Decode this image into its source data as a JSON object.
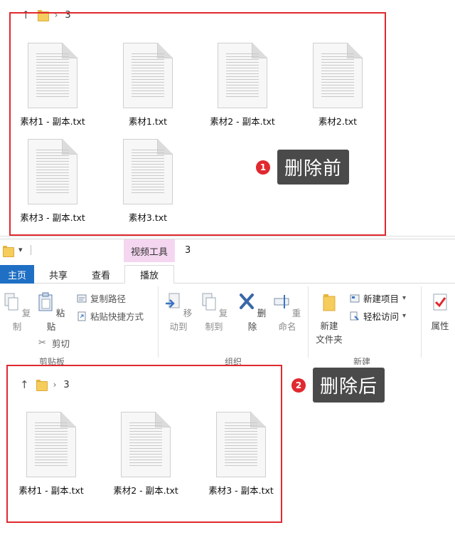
{
  "before": {
    "address": {
      "folder": "3"
    },
    "files": [
      "素材1 - 副本.txt",
      "素材1.txt",
      "素材2 - 副本.txt",
      "素材2.txt",
      "素材3 - 副本.txt",
      "素材3.txt"
    ],
    "callout": {
      "number": "1",
      "label": "删除前"
    }
  },
  "ribbon": {
    "context_tab": "视频工具",
    "window_title": "3",
    "tabs": {
      "home": "主页",
      "share": "共享",
      "view": "查看",
      "play": "播放"
    },
    "clipboard": {
      "copy": "复制",
      "paste": "粘贴",
      "copy_path": "复制路径",
      "paste_shortcut": "粘贴快捷方式",
      "cut": "剪切",
      "group": "剪贴板"
    },
    "organize": {
      "move_to": "移动到",
      "copy_to": "复制到",
      "delete": "删除",
      "rename": "重命名",
      "group": "组织"
    },
    "new": {
      "new_folder_line1": "新建",
      "new_folder_line2": "文件夹",
      "new_item": "新建项目",
      "easy_access": "轻松访问",
      "group": "新建"
    },
    "open": {
      "properties": "属性"
    }
  },
  "after": {
    "address": {
      "folder": "3"
    },
    "files": [
      "素材1 - 副本.txt",
      "素材2 - 副本.txt",
      "素材3 - 副本.txt"
    ],
    "callout": {
      "number": "2",
      "label": "删除后"
    }
  },
  "colors": {
    "highlight_red": "#e0292f",
    "callout_bg": "#4a4a4a",
    "home_tab": "#1f6fc5",
    "context_tab": "#f5d6f0"
  }
}
